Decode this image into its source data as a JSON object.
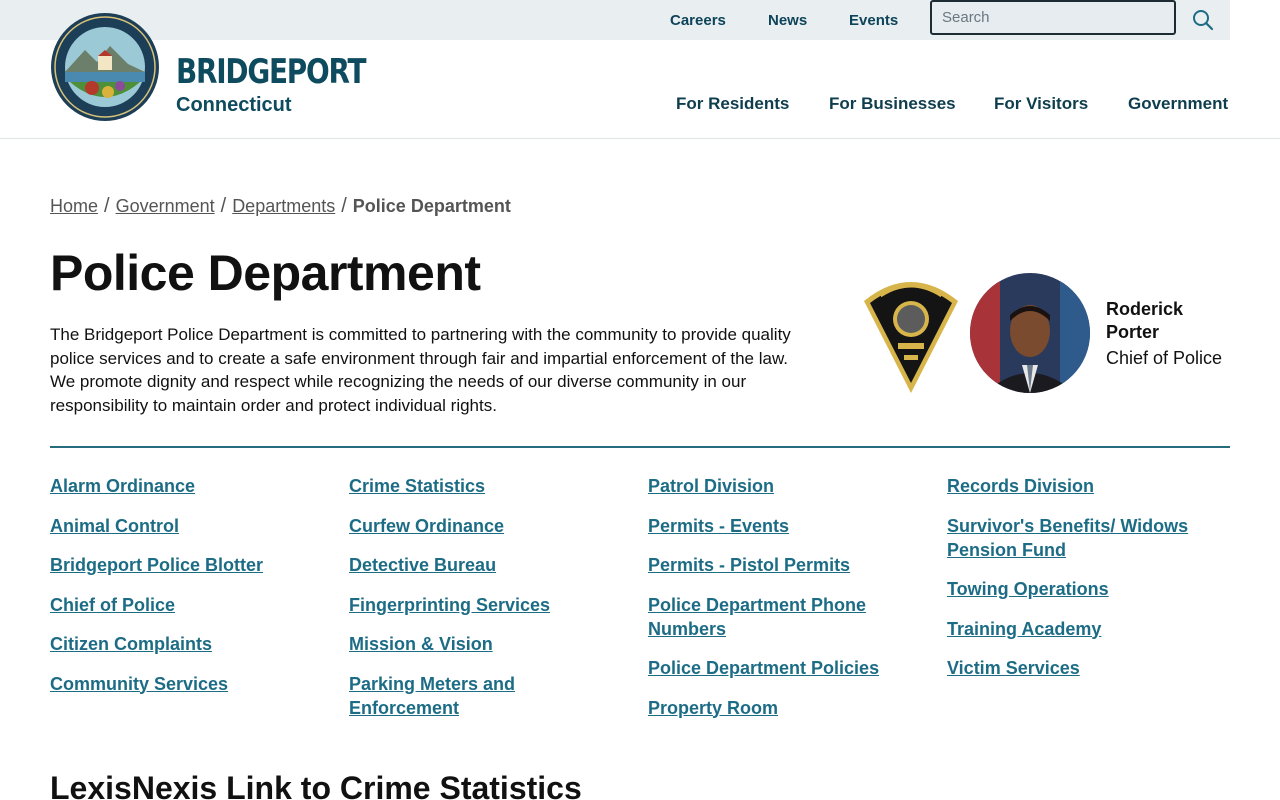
{
  "utility_nav": {
    "links": [
      "Careers",
      "News",
      "Events"
    ],
    "search_placeholder": "Search"
  },
  "brand": {
    "name": "BRIDGEPORT",
    "subtitle": "Connecticut"
  },
  "main_nav": [
    "For Residents",
    "For Businesses",
    "For Visitors",
    "Government"
  ],
  "breadcrumb": {
    "items": [
      "Home",
      "Government",
      "Departments"
    ],
    "current": "Police Department"
  },
  "page": {
    "title": "Police Department",
    "intro": "The Bridgeport Police Department is committed to partnering with the community to provide quality police services and to create a safe environment through fair and impartial enforcement of the law. We promote dignity and respect while recognizing the needs of our diverse community in our responsibility to maintain order and protect individual rights."
  },
  "chief": {
    "name": "Roderick Porter",
    "title": "Chief of Police"
  },
  "links": {
    "col1": [
      "Alarm Ordinance",
      "Animal Control",
      "Bridgeport Police Blotter",
      "Chief of Police",
      "Citizen Complaints",
      "Community Services"
    ],
    "col2": [
      "Crime Statistics",
      "Curfew Ordinance",
      "Detective Bureau",
      "Fingerprinting Services",
      "Mission & Vision",
      "Parking Meters and Enforcement"
    ],
    "col3": [
      "Patrol Division",
      "Permits - Events",
      "Permits - Pistol Permits",
      "Police Department Phone Numbers",
      "Police Department Policies",
      "Property Room"
    ],
    "col4": [
      "Records Division",
      "Survivor's Benefits/ Widows Pension Fund",
      "Towing Operations",
      "Training Academy",
      "Victim Services"
    ]
  },
  "subheading": "LexisNexis Link to Crime Statistics",
  "colors": {
    "brand": "#0e4b5f",
    "link": "#1d6c86",
    "rule": "#266b7e",
    "utility_bg": "#e9eef1"
  }
}
